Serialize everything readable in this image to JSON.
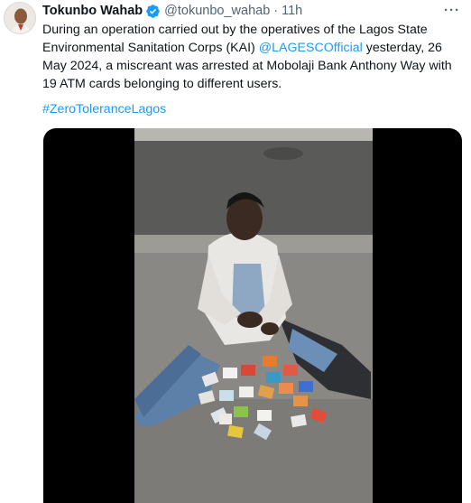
{
  "tweet": {
    "author_name": "Tokunbo Wahab",
    "handle": "@tokunbo_wahab",
    "separator": "·",
    "time": "11h",
    "verified_icon": "verified-badge-icon",
    "more_icon": "more-horizontal-icon",
    "more_label": "···",
    "text_before_mention": "During an operation carried out by the operatives of the Lagos State Environmental Sanitation Corps (KAI) ",
    "mention": "@LAGESCOfficial",
    "text_after_mention": " yesterday, 26 May 2024, a miscreant was arrested at Mobolaji Bank Anthony Way with 19 ATM cards belonging to different users.",
    "hashtag": "#ZeroToleranceLagos",
    "media_alt": "video-thumbnail"
  },
  "colors": {
    "link": "#1d9bf0",
    "text": "#0f1419",
    "secondary": "#536471",
    "verified": "#1d9bf0"
  }
}
